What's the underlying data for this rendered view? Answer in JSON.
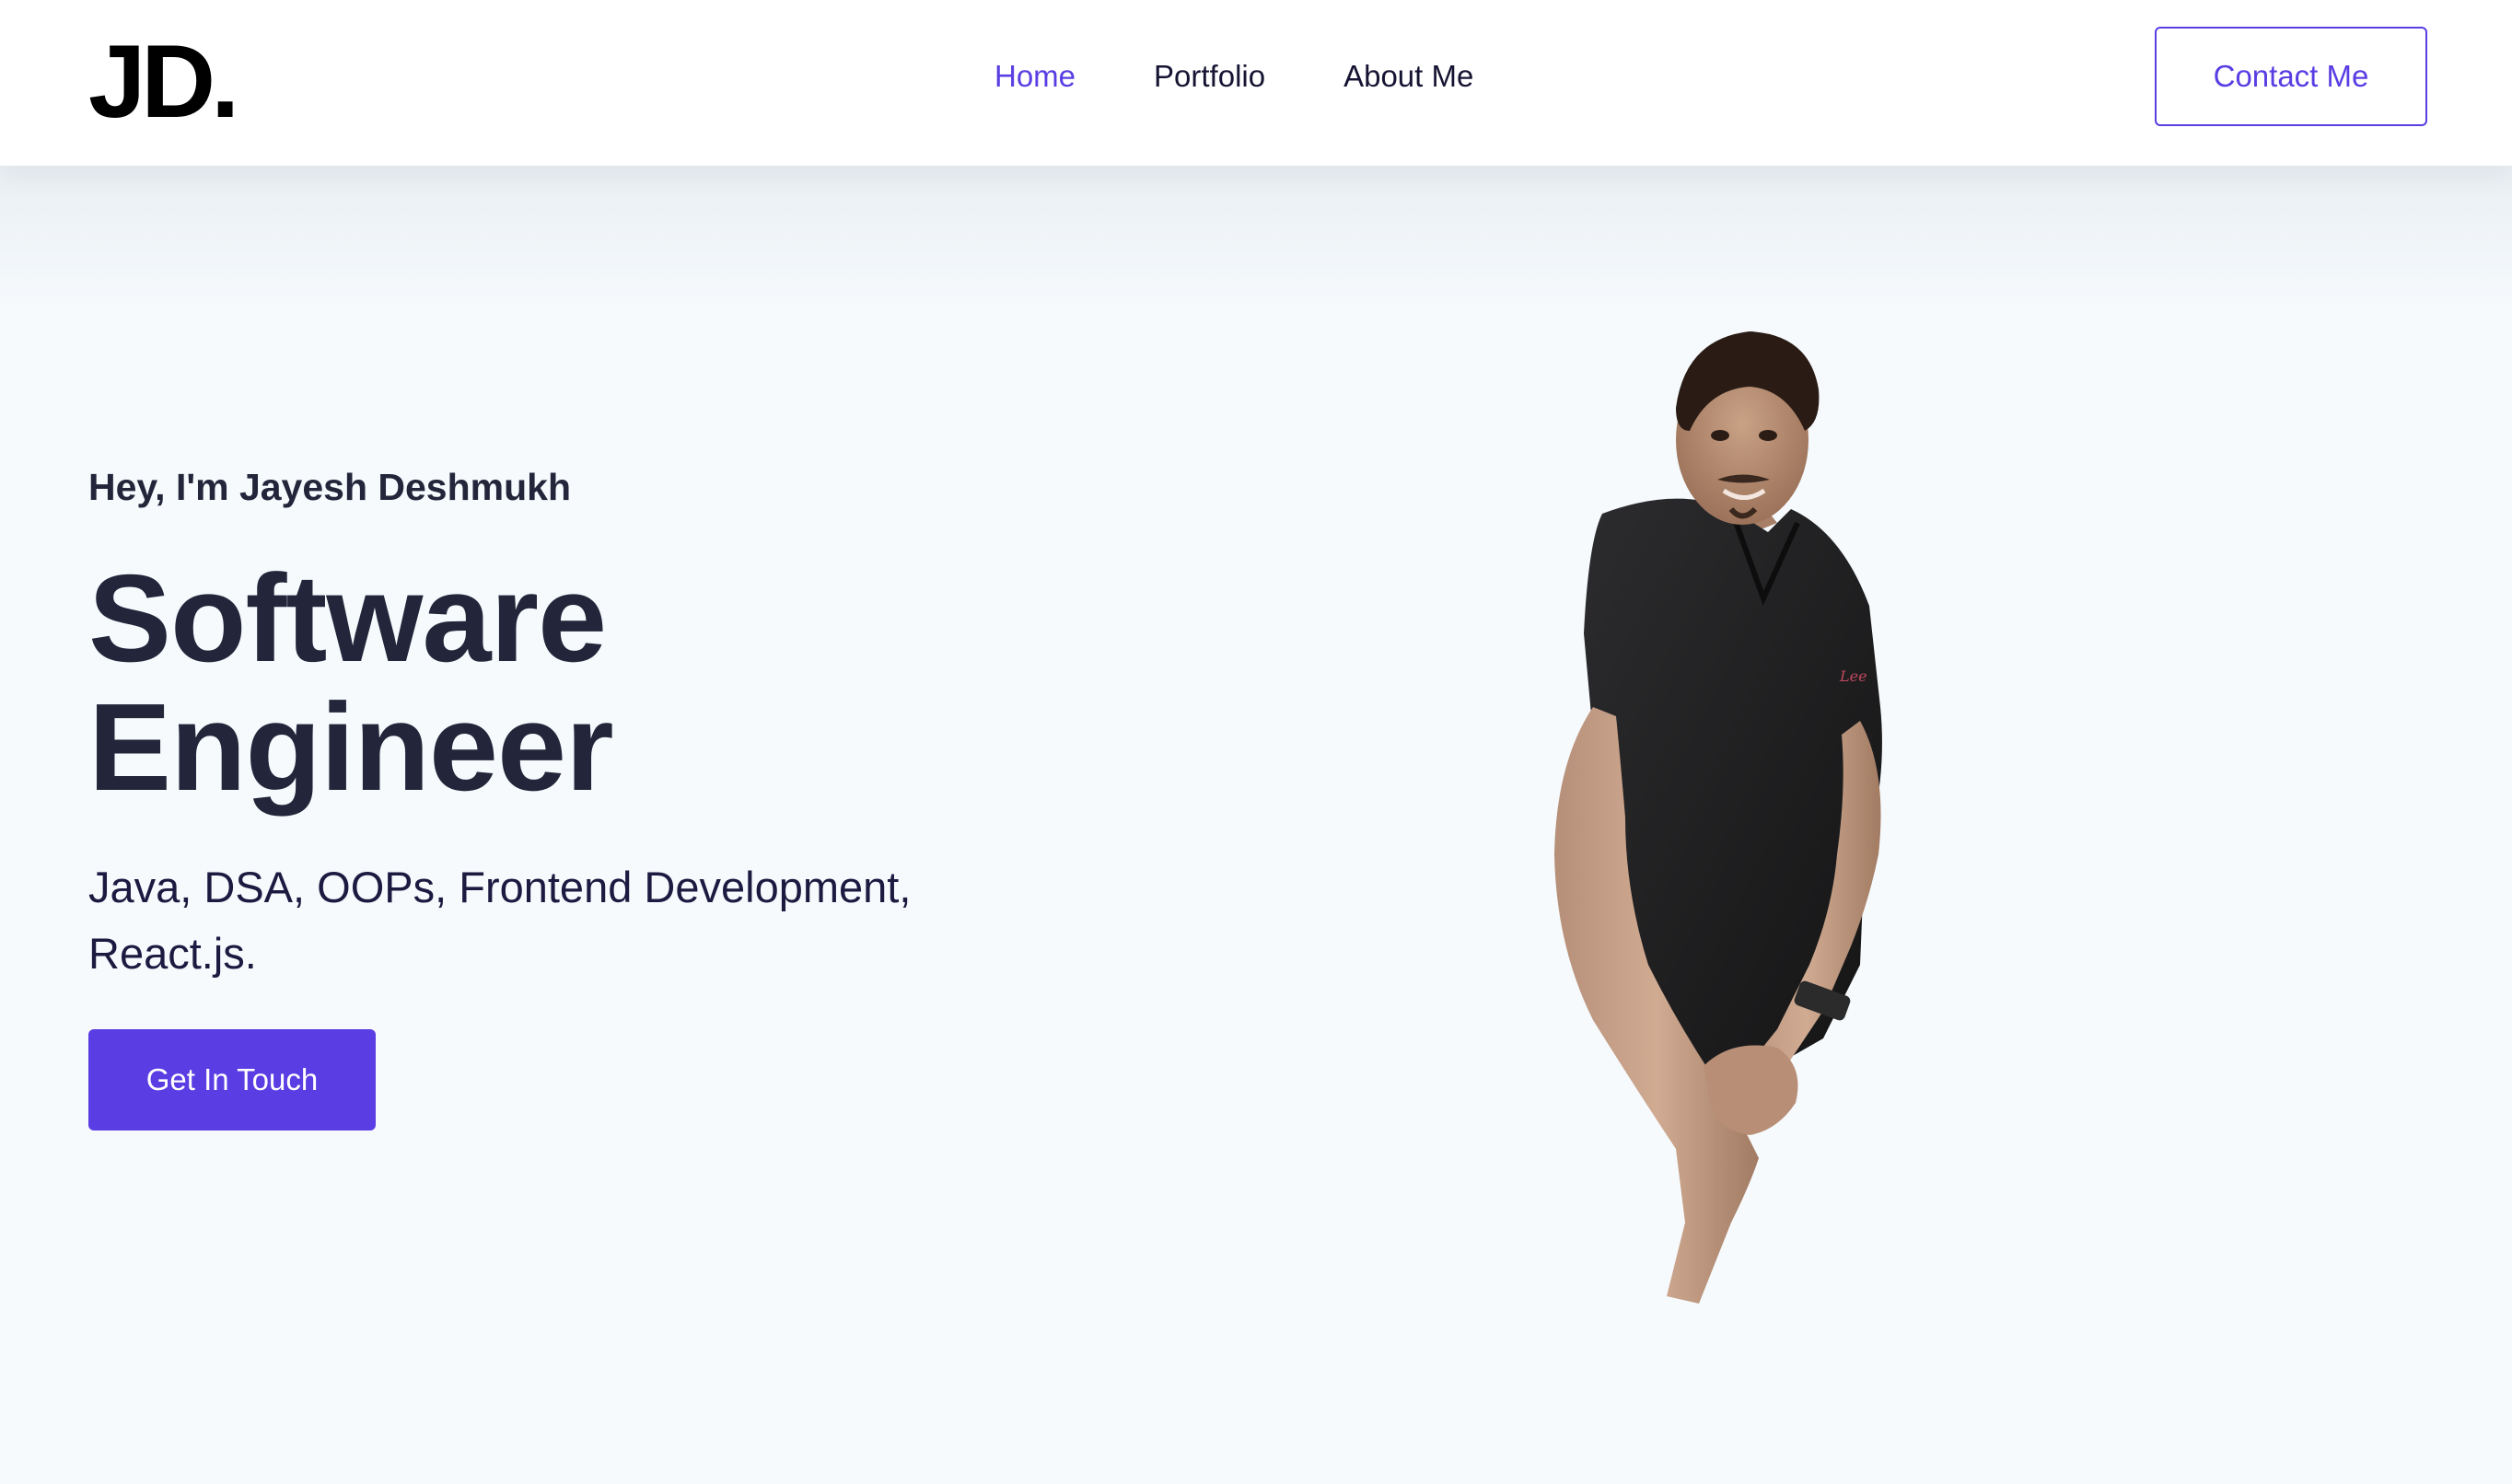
{
  "navbar": {
    "logo": "JD.",
    "links": [
      {
        "label": "Home",
        "active": true
      },
      {
        "label": "Portfolio",
        "active": false
      },
      {
        "label": "About Me",
        "active": false
      }
    ],
    "contact_button": "Contact Me"
  },
  "hero": {
    "greeting": "Hey, I'm Jayesh Deshmukh",
    "title_line1": "Software",
    "title_line2": "Engineer",
    "skills": "Java, DSA, OOPs, Frontend Development, React.js.",
    "cta_button": "Get In Touch",
    "portrait_shirt_logo": "Lee"
  },
  "colors": {
    "accent": "#5a3de3",
    "heading": "#23263a",
    "background": "#f6fafd"
  }
}
